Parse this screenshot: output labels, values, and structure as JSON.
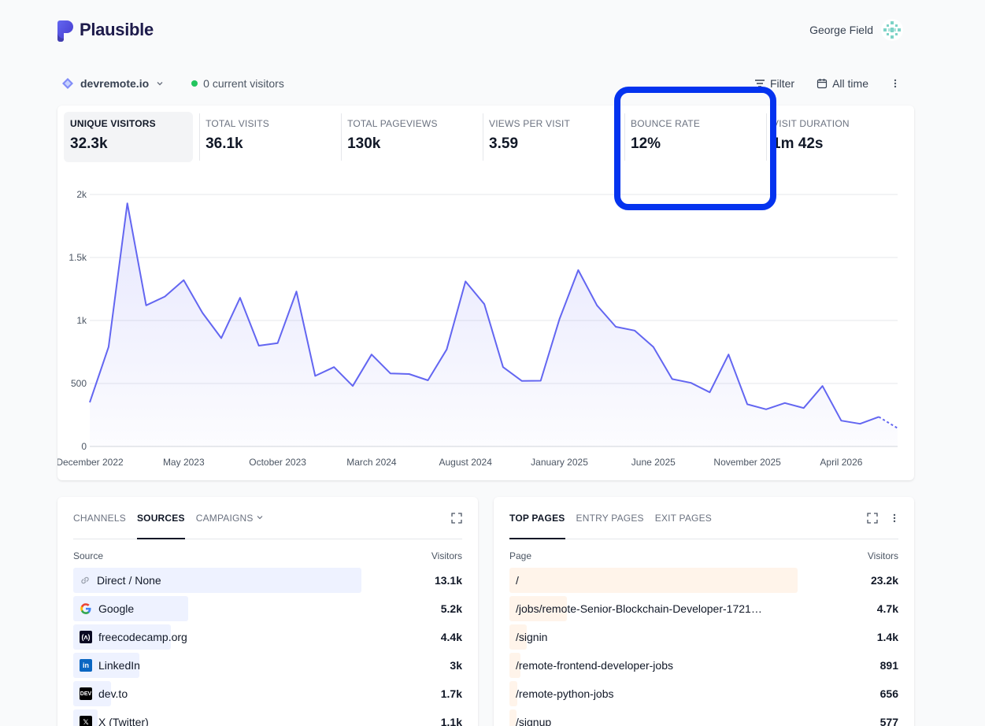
{
  "brand": {
    "name": "Plausible"
  },
  "user": {
    "name": "George Field"
  },
  "site": {
    "domain": "devremote.io",
    "current_visitors": "0 current visitors"
  },
  "controls": {
    "filter": "Filter",
    "period": "All time"
  },
  "metrics": [
    {
      "label": "UNIQUE VISITORS",
      "value": "32.3k"
    },
    {
      "label": "TOTAL VISITS",
      "value": "36.1k"
    },
    {
      "label": "TOTAL PAGEVIEWS",
      "value": "130k"
    },
    {
      "label": "VIEWS PER VISIT",
      "value": "3.59"
    },
    {
      "label": "BOUNCE RATE",
      "value": "12%"
    },
    {
      "label": "VISIT DURATION",
      "value": "1m 42s"
    }
  ],
  "chart_data": {
    "type": "area",
    "title": "",
    "xlabel": "",
    "ylabel": "",
    "ylim": [
      0,
      2000
    ],
    "yticks": [
      0,
      500,
      1000,
      1500,
      2000
    ],
    "ytick_labels": [
      "0",
      "500",
      "1k",
      "1.5k",
      "2k"
    ],
    "xtick_labels": [
      "December 2022",
      "May 2023",
      "October 2023",
      "March 2024",
      "August 2024",
      "January 2025",
      "June 2025",
      "November 2025",
      "April 2026"
    ],
    "xtick_positions": [
      0,
      5,
      10,
      15,
      20,
      25,
      30,
      35,
      40
    ],
    "grid": true,
    "color": "#6366f1",
    "series": [
      {
        "name": "Unique visitors",
        "values": [
          350,
          790,
          1930,
          1120,
          1190,
          1320,
          1060,
          860,
          1180,
          800,
          820,
          1230,
          560,
          630,
          480,
          730,
          580,
          575,
          525,
          770,
          1310,
          1130,
          630,
          520,
          522,
          1010,
          1400,
          1120,
          950,
          920,
          790,
          535,
          505,
          430,
          730,
          335,
          295,
          345,
          305,
          480,
          205,
          180,
          235,
          145
        ],
        "incomplete_last_point": true
      }
    ]
  },
  "sources_panel": {
    "tabs": [
      "CHANNELS",
      "SOURCES",
      "CAMPAIGNS"
    ],
    "active_tab": "SOURCES",
    "col_label": "Source",
    "col_value": "Visitors",
    "rows": [
      {
        "label": "Direct / None",
        "value": "13.1k",
        "share": 1.0,
        "icon": "link-icon"
      },
      {
        "label": "Google",
        "value": "5.2k",
        "share": 0.4,
        "icon": "google-icon"
      },
      {
        "label": "freecodecamp.org",
        "value": "4.4k",
        "share": 0.34,
        "icon": "freecodecamp-icon"
      },
      {
        "label": "LinkedIn",
        "value": "3k",
        "share": 0.23,
        "icon": "linkedin-icon"
      },
      {
        "label": "dev.to",
        "value": "1.7k",
        "share": 0.13,
        "icon": "devto-icon"
      },
      {
        "label": "X (Twitter)",
        "value": "1.1k",
        "share": 0.085,
        "icon": "x-icon"
      }
    ]
  },
  "pages_panel": {
    "tabs": [
      "TOP PAGES",
      "ENTRY PAGES",
      "EXIT PAGES"
    ],
    "active_tab": "TOP PAGES",
    "col_label": "Page",
    "col_value": "Visitors",
    "rows": [
      {
        "label": "/",
        "value": "23.2k",
        "share": 1.0
      },
      {
        "label": "/jobs/remote-Senior-Blockchain-Developer-1721…",
        "value": "4.7k",
        "share": 0.2
      },
      {
        "label": "/signin",
        "value": "1.4k",
        "share": 0.06
      },
      {
        "label": "/remote-frontend-developer-jobs",
        "value": "891",
        "share": 0.038
      },
      {
        "label": "/remote-python-jobs",
        "value": "656",
        "share": 0.028
      },
      {
        "label": "/signup",
        "value": "577",
        "share": 0.025
      }
    ]
  }
}
